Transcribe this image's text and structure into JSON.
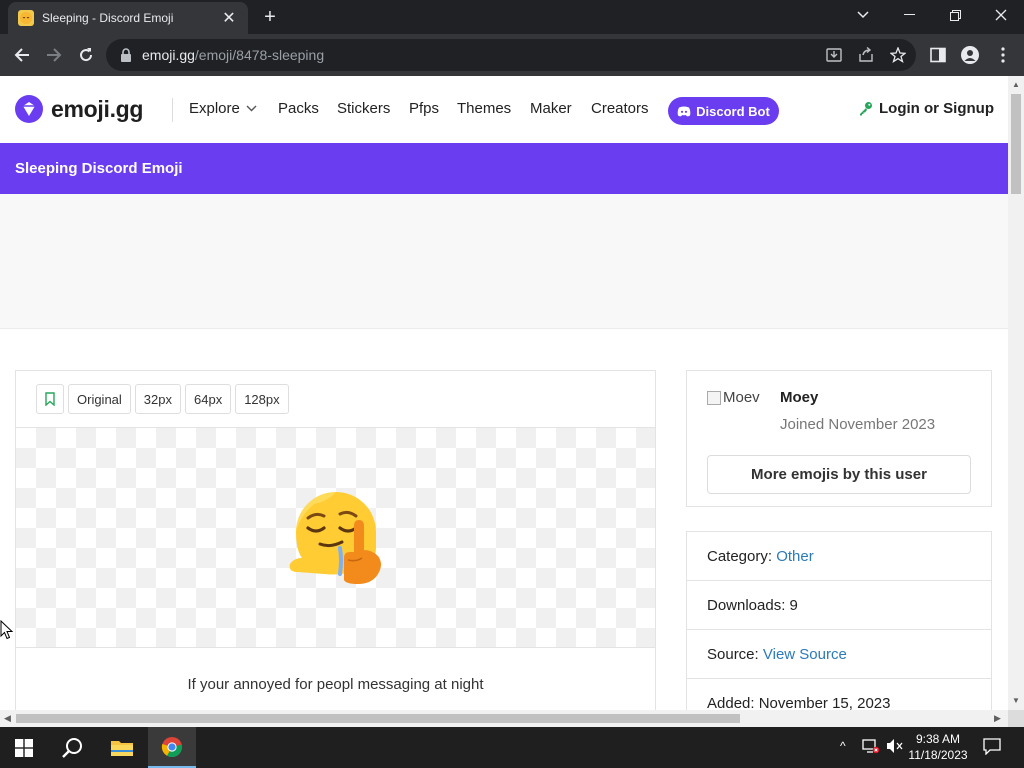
{
  "browser": {
    "tab_title": "Sleeping - Discord Emoji",
    "url_host": "emoji.gg",
    "url_path": "/emoji/8478-sleeping"
  },
  "site": {
    "logo_text": "emoji.gg",
    "nav": {
      "explore": "Explore",
      "packs": "Packs",
      "stickers": "Stickers",
      "pfps": "Pfps",
      "themes": "Themes",
      "maker": "Maker",
      "creators": "Creators",
      "discord_bot": "Discord Bot",
      "login": "Login or Signup"
    },
    "accent_color": "#6a3df0"
  },
  "banner": {
    "title": "Sleeping Discord Emoji"
  },
  "emoji_card": {
    "sizes": [
      "Original",
      "32px",
      "64px",
      "128px"
    ],
    "description": "If your annoyed for peopl messaging at night"
  },
  "user_card": {
    "avatar_alt": "Moev",
    "name": "Moey",
    "joined": "Joined November 2023",
    "more_button": "More emojis by this user"
  },
  "info": {
    "category_label": "Category: ",
    "category_value": "Other",
    "downloads_label": "Downloads: ",
    "downloads_value": "9",
    "source_label": "Source: ",
    "source_value": "View Source",
    "added_label": "Added: ",
    "added_value": "November 15, 2023"
  },
  "taskbar": {
    "time": "9:38 AM",
    "date": "11/18/2023"
  }
}
